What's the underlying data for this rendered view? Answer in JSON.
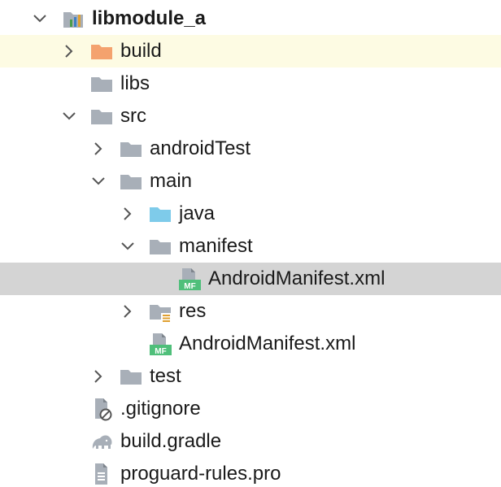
{
  "project_tree": {
    "root": {
      "label": "libmodule_a",
      "icon": "module-icon",
      "expanded": true
    },
    "items": [
      {
        "label": "build",
        "icon": "folder-excluded-icon",
        "expanded": false
      },
      {
        "label": "libs",
        "icon": "folder-icon"
      },
      {
        "label": "src",
        "icon": "folder-icon",
        "expanded": true
      },
      {
        "label": "androidTest",
        "icon": "folder-icon",
        "expanded": false
      },
      {
        "label": "main",
        "icon": "folder-icon",
        "expanded": true
      },
      {
        "label": "java",
        "icon": "source-folder-icon",
        "expanded": false
      },
      {
        "label": "manifest",
        "icon": "folder-icon",
        "expanded": true
      },
      {
        "label": "AndroidManifest.xml",
        "icon": "manifest-file-icon",
        "badge": "MF",
        "selected": true
      },
      {
        "label": "res",
        "icon": "resource-folder-icon",
        "expanded": false
      },
      {
        "label": "AndroidManifest.xml",
        "icon": "manifest-file-icon",
        "badge": "MF"
      },
      {
        "label": "test",
        "icon": "folder-icon",
        "expanded": false
      },
      {
        "label": ".gitignore",
        "icon": "ignored-file-icon"
      },
      {
        "label": "build.gradle",
        "icon": "gradle-elephant-icon"
      },
      {
        "label": "proguard-rules.pro",
        "icon": "text-file-icon"
      }
    ]
  },
  "colors": {
    "folder": "#a8afb8",
    "excluded_folder": "#f4a26e",
    "source_folder": "#7ecbea",
    "manifest_badge": "#4fbf7a",
    "hover_row": "#fdfbe3",
    "selected_row": "#d4d4d4"
  }
}
